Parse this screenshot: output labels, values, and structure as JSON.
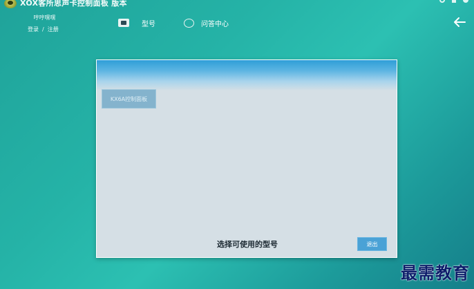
{
  "window": {
    "title": "XOX客所思声卡控制面板 版本",
    "controls": [
      "gear-icon",
      "minimize-icon",
      "close-icon"
    ]
  },
  "user": {
    "name": "哼哼嘿嘿",
    "login_label": "登录",
    "separator": "/",
    "register_label": "注册"
  },
  "nav": {
    "tabs": [
      {
        "label": "型号",
        "icon": "device-icon"
      },
      {
        "label": "问答中心",
        "icon": "chat-bubble-icon"
      }
    ],
    "back_icon": "back-arrow-icon"
  },
  "panel": {
    "model_button_label": "KX6A控制面板",
    "prompt": "选择可使用的型号",
    "exit_label": "退出"
  },
  "watermark": "最需教育",
  "colors": {
    "background": "#25b3a7",
    "panel_bg": "#d5dfe5",
    "header_blue": "#2f9ed7",
    "exit_button": "#4aa2d6",
    "watermark": "#0d1d6a"
  }
}
